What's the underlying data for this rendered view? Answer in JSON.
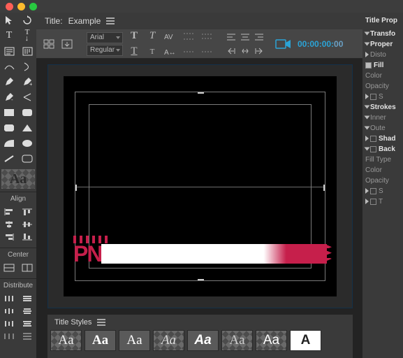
{
  "header": {
    "title_label": "Title:",
    "title_value": "Example"
  },
  "font": {
    "family": "Arial",
    "weight": "Regular"
  },
  "timecode": {
    "value_main": "00:00:00:",
    "value_frames": "00"
  },
  "type_sample": "Aa",
  "panels": {
    "align": "Align",
    "center": "Center",
    "distribute": "Distribute"
  },
  "lower_third": {
    "logo_text": "PN"
  },
  "styles_panel": {
    "title": "Title Styles"
  },
  "style_swatches": [
    {
      "label": "Aa",
      "fam": "serif",
      "style": "normal",
      "weight": "normal",
      "color": "#eee",
      "class": "sw-checker"
    },
    {
      "label": "Aa",
      "fam": "serif",
      "style": "normal",
      "weight": "bold",
      "color": "#fff",
      "class": ""
    },
    {
      "label": "Aa",
      "fam": "serif",
      "style": "normal",
      "weight": "normal",
      "color": "#fff",
      "class": ""
    },
    {
      "label": "Aa",
      "fam": "cursive",
      "style": "italic",
      "weight": "normal",
      "color": "#ddd",
      "class": "sw-checker"
    },
    {
      "label": "Aa",
      "fam": "sans",
      "style": "italic",
      "weight": "bold",
      "color": "#fff",
      "class": ""
    },
    {
      "label": "Aa",
      "fam": "serif",
      "style": "normal",
      "weight": "normal",
      "color": "#ccc",
      "class": "sw-checker"
    },
    {
      "label": "Aa",
      "fam": "sans",
      "style": "normal",
      "weight": "normal",
      "color": "#fff",
      "class": "sw-checker"
    },
    {
      "label": "A",
      "fam": "sans",
      "style": "normal",
      "weight": "900",
      "color": "#222",
      "class": "",
      "bg": "#fff"
    }
  ],
  "properties": {
    "panel_title": "Title Prop",
    "groups": {
      "transform": "Transfo",
      "properties": "Proper",
      "distort": "Disto",
      "fill": "Fill",
      "color": "Color",
      "opacity": "Opacity",
      "s1": "S",
      "strokes": "Strokes",
      "inner": "Inner",
      "outer": "Oute",
      "shadow": "Shad",
      "background": "Back",
      "fill_type": "Fill Type",
      "s2": "S",
      "t": "T"
    }
  }
}
